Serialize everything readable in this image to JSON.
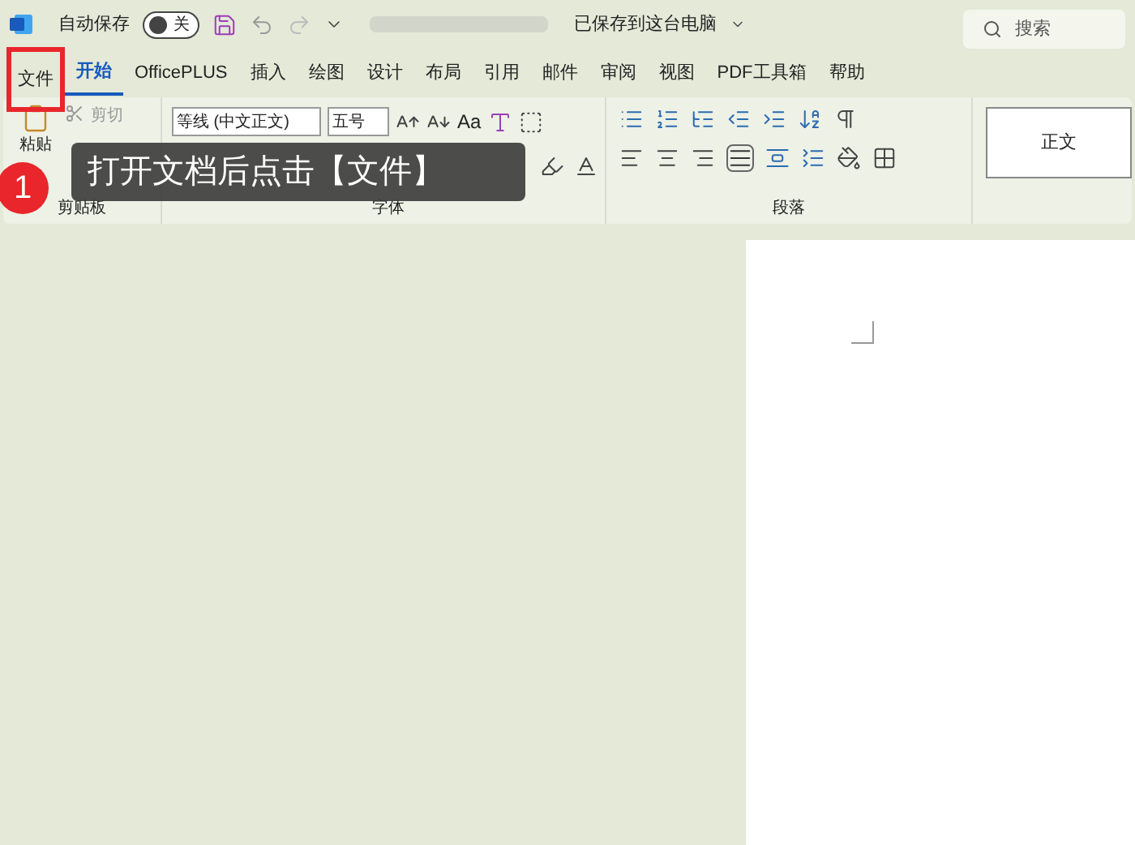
{
  "title_bar": {
    "autosave_label": "自动保存",
    "autosave": {
      "on": false,
      "label": "关"
    },
    "save_status": "已保存到这台电脑",
    "search": {
      "placeholder": "搜索"
    }
  },
  "tabs": [
    {
      "label": "文件",
      "selected": false,
      "highlighted": true
    },
    {
      "label": "开始",
      "selected": true,
      "highlighted": false
    },
    {
      "label": "OfficePLUS",
      "selected": false,
      "highlighted": false
    },
    {
      "label": "插入",
      "selected": false,
      "highlighted": false
    },
    {
      "label": "绘图",
      "selected": false,
      "highlighted": false
    },
    {
      "label": "设计",
      "selected": false,
      "highlighted": false
    },
    {
      "label": "布局",
      "selected": false,
      "highlighted": false
    },
    {
      "label": "引用",
      "selected": false,
      "highlighted": false
    },
    {
      "label": "邮件",
      "selected": false,
      "highlighted": false
    },
    {
      "label": "审阅",
      "selected": false,
      "highlighted": false
    },
    {
      "label": "视图",
      "selected": false,
      "highlighted": false
    },
    {
      "label": "PDF工具箱",
      "selected": false,
      "highlighted": false
    },
    {
      "label": "帮助",
      "selected": false,
      "highlighted": false
    }
  ],
  "ribbon": {
    "clipboard": {
      "paste": "粘贴",
      "cut": "剪切",
      "group_label": "剪贴板"
    },
    "font": {
      "font_name": "等线 (中文正文)",
      "font_size": "五号",
      "case_button": "Aa",
      "group_label": "字体"
    },
    "paragraph": {
      "group_label": "段落"
    },
    "styles": {
      "style_name": "正文"
    }
  },
  "callout": {
    "step": "1",
    "text": "打开文档后点击【文件】"
  }
}
